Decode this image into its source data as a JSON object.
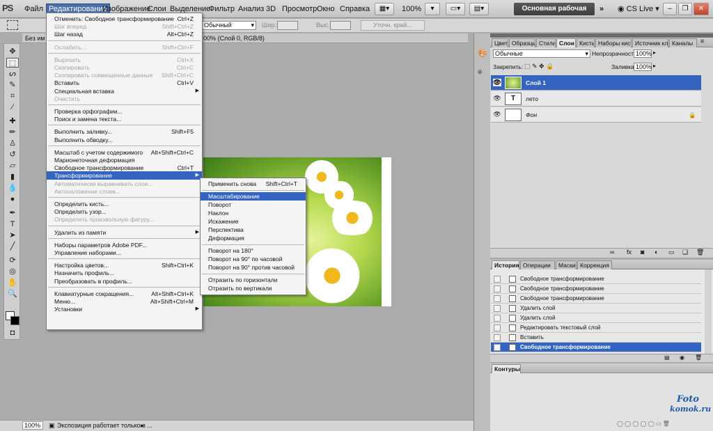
{
  "app": {
    "logo": "PS"
  },
  "menubar": {
    "items": [
      "Файл",
      "Редактирование",
      "Изображение",
      "Слои",
      "Выделение",
      "Фильтр",
      "Анализ",
      "3D",
      "Просмотр",
      "Окно",
      "Справка"
    ],
    "zoom": "100%",
    "workspace": "Основная рабочая среда",
    "more": "»",
    "cslive": "CS Live"
  },
  "options": {
    "blend": "Обычный",
    "width_label": "Шир.:",
    "height_label": "Выс.:",
    "refine": "Уточн. край..."
  },
  "document": {
    "tab_title": "Без им",
    "tab_suffix": "00% (Слой 0, RGB/8)",
    "status_zoom": "100%",
    "status_text": "Экспозиция работает только в ..."
  },
  "edit_menu": [
    {
      "label": "Отменить: Свободное трансформирование",
      "shortcut": "Ctrl+Z",
      "state": "normal"
    },
    {
      "label": "Шаг вперед",
      "shortcut": "Shift+Ctrl+Z",
      "state": "dim"
    },
    {
      "label": "Шаг назад",
      "shortcut": "Alt+Ctrl+Z",
      "state": "normal"
    },
    {
      "sep": true
    },
    {
      "label": "Ослабить...",
      "shortcut": "Shift+Ctrl+F",
      "state": "dim"
    },
    {
      "sep": true
    },
    {
      "label": "Вырезать",
      "shortcut": "Ctrl+X",
      "state": "dim"
    },
    {
      "label": "Скопировать",
      "shortcut": "Ctrl+C",
      "state": "dim"
    },
    {
      "label": "Скопировать совмещенные данные",
      "shortcut": "Shift+Ctrl+C",
      "state": "dim"
    },
    {
      "label": "Вставить",
      "shortcut": "Ctrl+V",
      "state": "normal"
    },
    {
      "label": "Специальная вставка",
      "shortcut": "",
      "state": "normal",
      "submenu": true
    },
    {
      "label": "Очистить",
      "shortcut": "",
      "state": "dim"
    },
    {
      "sep": true
    },
    {
      "label": "Проверка орфографии...",
      "shortcut": "",
      "state": "normal"
    },
    {
      "label": "Поиск и замена текста...",
      "shortcut": "",
      "state": "normal"
    },
    {
      "sep": true
    },
    {
      "label": "Выполнить заливку...",
      "shortcut": "Shift+F5",
      "state": "normal"
    },
    {
      "label": "Выполнить обводку...",
      "shortcut": "",
      "state": "normal"
    },
    {
      "sep": true
    },
    {
      "label": "Масштаб с учетом содержимого",
      "shortcut": "Alt+Shift+Ctrl+C",
      "state": "normal"
    },
    {
      "label": "Марионеточная деформация",
      "shortcut": "",
      "state": "normal"
    },
    {
      "label": "Свободное трансформирование",
      "shortcut": "Ctrl+T",
      "state": "normal"
    },
    {
      "label": "Трансформирование",
      "shortcut": "",
      "state": "sel",
      "submenu": true
    },
    {
      "label": "Автоматически выравнивать слои...",
      "shortcut": "",
      "state": "dim"
    },
    {
      "label": "Автоналожение слоев...",
      "shortcut": "",
      "state": "dim"
    },
    {
      "sep": true
    },
    {
      "label": "Определить кисть...",
      "shortcut": "",
      "state": "normal"
    },
    {
      "label": "Определить узор...",
      "shortcut": "",
      "state": "normal"
    },
    {
      "label": "Определить произвольную фигуру...",
      "shortcut": "",
      "state": "dim"
    },
    {
      "sep": true
    },
    {
      "label": "Удалить из памяти",
      "shortcut": "",
      "state": "normal",
      "submenu": true
    },
    {
      "sep": true
    },
    {
      "label": "Наборы параметров Adobe PDF...",
      "shortcut": "",
      "state": "normal"
    },
    {
      "label": "Управление наборами...",
      "shortcut": "",
      "state": "normal"
    },
    {
      "sep": true
    },
    {
      "label": "Настройка цветов...",
      "shortcut": "Shift+Ctrl+K",
      "state": "normal"
    },
    {
      "label": "Назначить профиль...",
      "shortcut": "",
      "state": "normal"
    },
    {
      "label": "Преобразовать в профиль...",
      "shortcut": "",
      "state": "normal"
    },
    {
      "sep": true
    },
    {
      "label": "Клавиатурные сокращения...",
      "shortcut": "Alt+Shift+Ctrl+K",
      "state": "normal"
    },
    {
      "label": "Меню...",
      "shortcut": "Alt+Shift+Ctrl+M",
      "state": "normal"
    },
    {
      "label": "Установки",
      "shortcut": "",
      "state": "normal",
      "submenu": true
    }
  ],
  "transform_menu": [
    {
      "label": "Применить снова",
      "shortcut": "Shift+Ctrl+T",
      "state": "normal"
    },
    {
      "sep": true
    },
    {
      "label": "Масштабирование",
      "shortcut": "",
      "state": "sel"
    },
    {
      "label": "Поворот",
      "shortcut": "",
      "state": "normal"
    },
    {
      "label": "Наклон",
      "shortcut": "",
      "state": "normal"
    },
    {
      "label": "Искажение",
      "shortcut": "",
      "state": "normal"
    },
    {
      "label": "Перспектива",
      "shortcut": "",
      "state": "normal"
    },
    {
      "label": "Деформация",
      "shortcut": "",
      "state": "normal"
    },
    {
      "sep": true
    },
    {
      "label": "Поворот на 180°",
      "shortcut": "",
      "state": "normal"
    },
    {
      "label": "Поворот на 90° по часовой",
      "shortcut": "",
      "state": "normal"
    },
    {
      "label": "Поворот на 90° против часовой",
      "shortcut": "",
      "state": "normal"
    },
    {
      "sep": true
    },
    {
      "label": "Отразить по горизонтали",
      "shortcut": "",
      "state": "normal"
    },
    {
      "label": "Отразить по вертикали",
      "shortcut": "",
      "state": "normal"
    }
  ],
  "layers_panel": {
    "tabs": [
      "Цвет",
      "Образцы",
      "Стили",
      "Слои",
      "Кисть",
      "Наборы кисте",
      "Источник кл",
      "Каналы"
    ],
    "blend_mode": "Обычные",
    "opacity_label": "Непрозрачность:",
    "opacity": "100%",
    "lock_label": "Закрепить:",
    "fill_label": "Заливка:",
    "fill": "100%",
    "layers": [
      {
        "name": "Слой 1",
        "kind": "image",
        "selected": true
      },
      {
        "name": "лето",
        "kind": "text",
        "selected": false
      },
      {
        "name": "Фон",
        "kind": "background",
        "selected": false
      }
    ]
  },
  "history_panel": {
    "tabs": [
      "История",
      "Операции",
      "Маски",
      "Коррекция"
    ],
    "items": [
      {
        "label": "Свободное трансформирование",
        "selected": false
      },
      {
        "label": "Свободное трансформирование",
        "selected": false
      },
      {
        "label": "Свободное трансформирование",
        "selected": false
      },
      {
        "label": "Удалить слой",
        "selected": false
      },
      {
        "label": "Удалить слой",
        "selected": false
      },
      {
        "label": "Редактировать текстовый слой",
        "selected": false
      },
      {
        "label": "Вставить",
        "selected": false
      },
      {
        "label": "Свободное трансформирование",
        "selected": true
      }
    ]
  },
  "paths_panel": {
    "tab": "Контуры"
  },
  "watermark": {
    "line1": "Foto",
    "line2": "komok.ru"
  },
  "colors": {
    "accent": "#3464c2",
    "menu_active": "#4a6ea9"
  }
}
